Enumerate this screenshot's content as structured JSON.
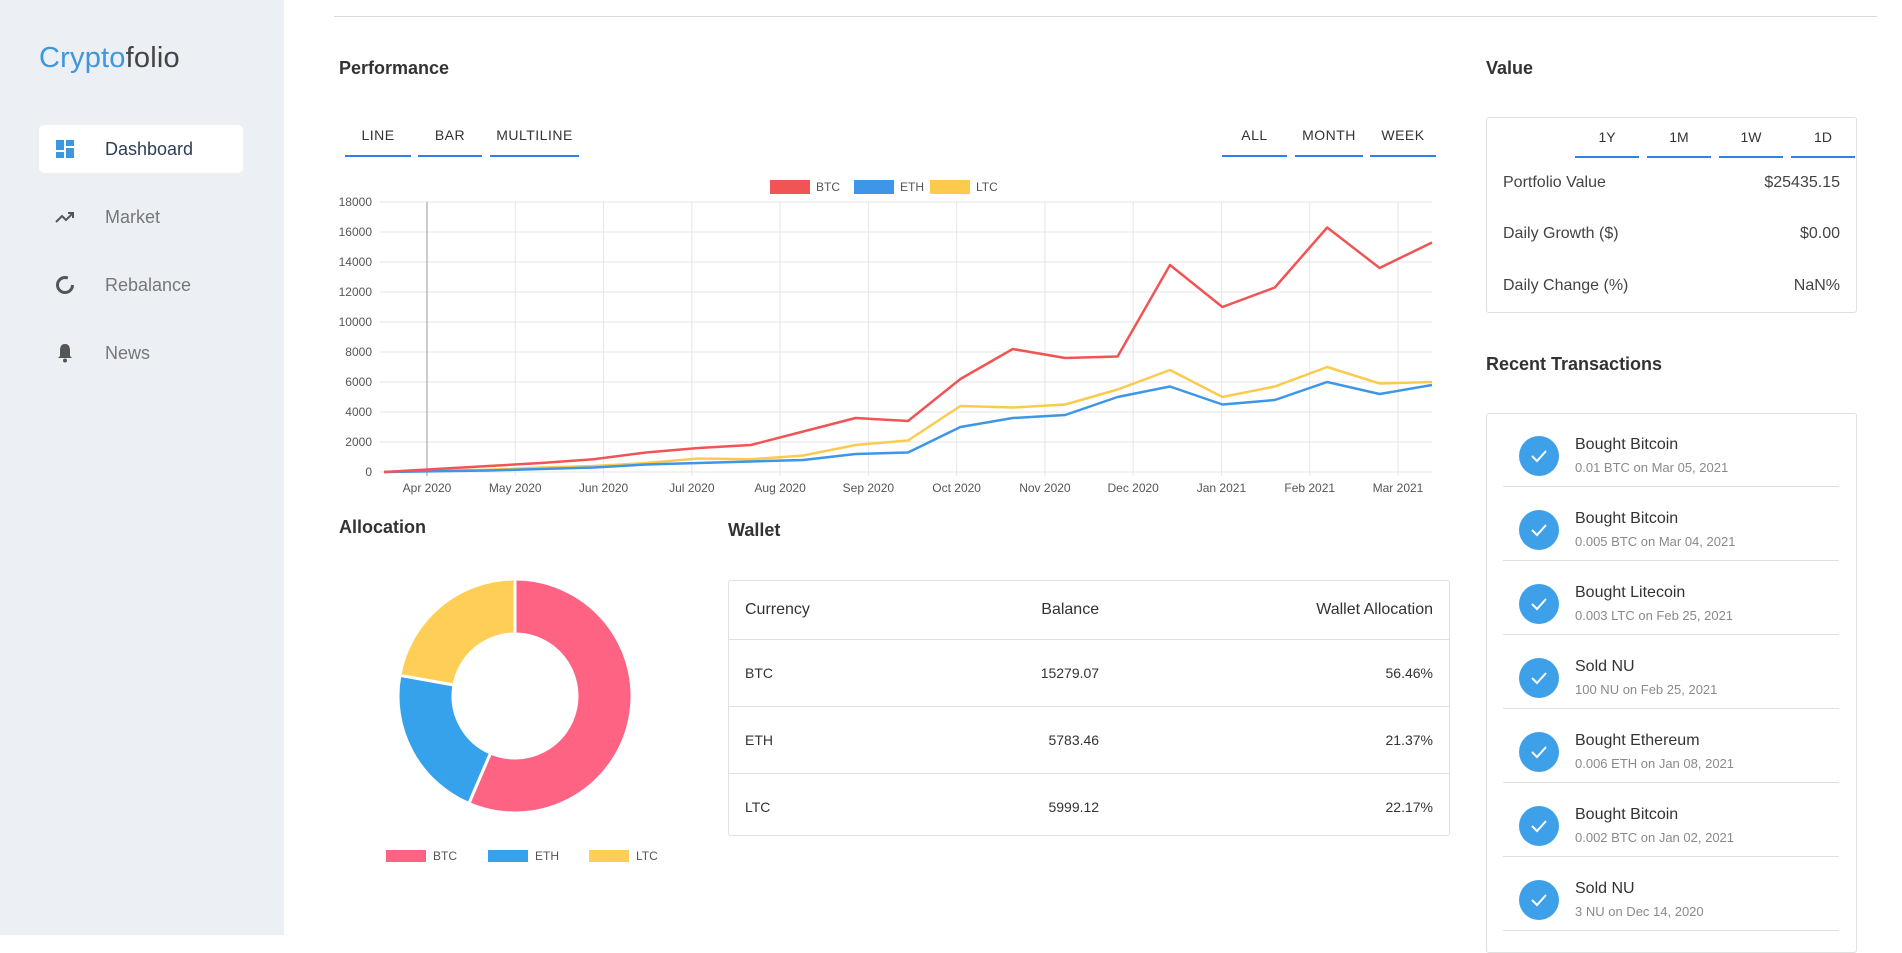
{
  "app": {
    "logo_part1": "Crypto",
    "logo_part2": "folio"
  },
  "sidebar": {
    "items": [
      {
        "label": "Dashboard",
        "icon": "dashboard-icon"
      },
      {
        "label": "Market",
        "icon": "trending-up-icon"
      },
      {
        "label": "Rebalance",
        "icon": "donut-icon"
      },
      {
        "label": "News",
        "icon": "bell-icon"
      }
    ]
  },
  "performance": {
    "title": "Performance",
    "chart_tabs": [
      "LINE",
      "BAR",
      "MULTILINE"
    ],
    "range_tabs": [
      "ALL",
      "MONTH",
      "WEEK"
    ]
  },
  "value_panel": {
    "title": "Value",
    "ranges": [
      "1Y",
      "1M",
      "1W",
      "1D"
    ],
    "rows": [
      {
        "label": "Portfolio Value",
        "value": "$25435.15"
      },
      {
        "label": "Daily Growth ($)",
        "value": "$0.00"
      },
      {
        "label": "Daily Change (%)",
        "value": "NaN%"
      }
    ]
  },
  "allocation": {
    "title": "Allocation"
  },
  "wallet": {
    "title": "Wallet",
    "columns": [
      "Currency",
      "Balance",
      "Wallet Allocation"
    ],
    "rows": [
      {
        "currency": "BTC",
        "balance": "15279.07",
        "allocation": "56.46%"
      },
      {
        "currency": "ETH",
        "balance": "5783.46",
        "allocation": "21.37%"
      },
      {
        "currency": "LTC",
        "balance": "5999.12",
        "allocation": "22.17%"
      }
    ]
  },
  "transactions": {
    "title": "Recent Transactions",
    "items": [
      {
        "title": "Bought Bitcoin",
        "sub": "0.01 BTC on Mar 05, 2021"
      },
      {
        "title": "Bought Bitcoin",
        "sub": "0.005 BTC on Mar 04, 2021"
      },
      {
        "title": "Bought Litecoin",
        "sub": "0.003 LTC on Feb 25, 2021"
      },
      {
        "title": "Sold NU",
        "sub": "100 NU on Feb 25, 2021"
      },
      {
        "title": "Bought Ethereum",
        "sub": "0.006 ETH on Jan 08, 2021"
      },
      {
        "title": "Bought Bitcoin",
        "sub": "0.002 BTC on Jan 02, 2021"
      },
      {
        "title": "Sold NU",
        "sub": "3 NU on Dec 14, 2020"
      }
    ]
  },
  "colors": {
    "accent": "#2f80ed",
    "btc_line": "#f05454",
    "eth_line": "#3d96e8",
    "ltc_line": "#fccb4e",
    "btc_pie": "#ff6384",
    "eth_pie": "#36a2eb",
    "ltc_pie": "#ffce56"
  },
  "chart_data": [
    {
      "type": "line",
      "legend": [
        "BTC",
        "ETH",
        "LTC"
      ],
      "legend_position": "top-center",
      "x_ticks": [
        "Apr 2020",
        "May 2020",
        "Jun 2020",
        "Jul 2020",
        "Aug 2020",
        "Sep 2020",
        "Oct 2020",
        "Nov 2020",
        "Dec 2020",
        "Jan 2021",
        "Feb 2021",
        "Mar 2021"
      ],
      "ylim": [
        0,
        18000
      ],
      "y_ticks": [
        0,
        2000,
        4000,
        6000,
        8000,
        10000,
        12000,
        14000,
        16000,
        18000
      ],
      "grid": true,
      "x": [
        "Mar 2020",
        "Apr 2020",
        "May 2020",
        "Jun 2020",
        "Jul 2020",
        "Aug 2020",
        "Sep 2020",
        "Oct 2020",
        "Nov 2020",
        "Dec 2020",
        "Dec 2020",
        "Jan 2021",
        "Jan 2021",
        "Jan 2021",
        "Jan 2021",
        "Feb 2021",
        "Feb 2021",
        "Feb 2021",
        "Mar 2021",
        "Mar 2021",
        "Mar 2021"
      ],
      "series": [
        {
          "name": "BTC",
          "values": [
            0,
            200,
            400,
            600,
            850,
            1300,
            1600,
            1800,
            2700,
            3600,
            3400,
            6200,
            8200,
            7600,
            7700,
            13800,
            11000,
            12300,
            16300,
            13600,
            15300
          ]
        },
        {
          "name": "ETH",
          "values": [
            0,
            50,
            100,
            200,
            300,
            500,
            600,
            700,
            800,
            1200,
            1300,
            3000,
            3600,
            3800,
            5000,
            5700,
            4500,
            4800,
            6000,
            5200,
            5800
          ]
        },
        {
          "name": "LTC",
          "values": [
            0,
            80,
            150,
            300,
            400,
            600,
            900,
            850,
            1100,
            1800,
            2100,
            4400,
            4300,
            4500,
            5500,
            6800,
            5000,
            5700,
            7000,
            5900,
            6000
          ]
        }
      ]
    },
    {
      "type": "pie",
      "categories": [
        "BTC",
        "ETH",
        "LTC"
      ],
      "values": [
        56.46,
        21.37,
        22.17
      ],
      "legend_position": "bottom"
    }
  ]
}
